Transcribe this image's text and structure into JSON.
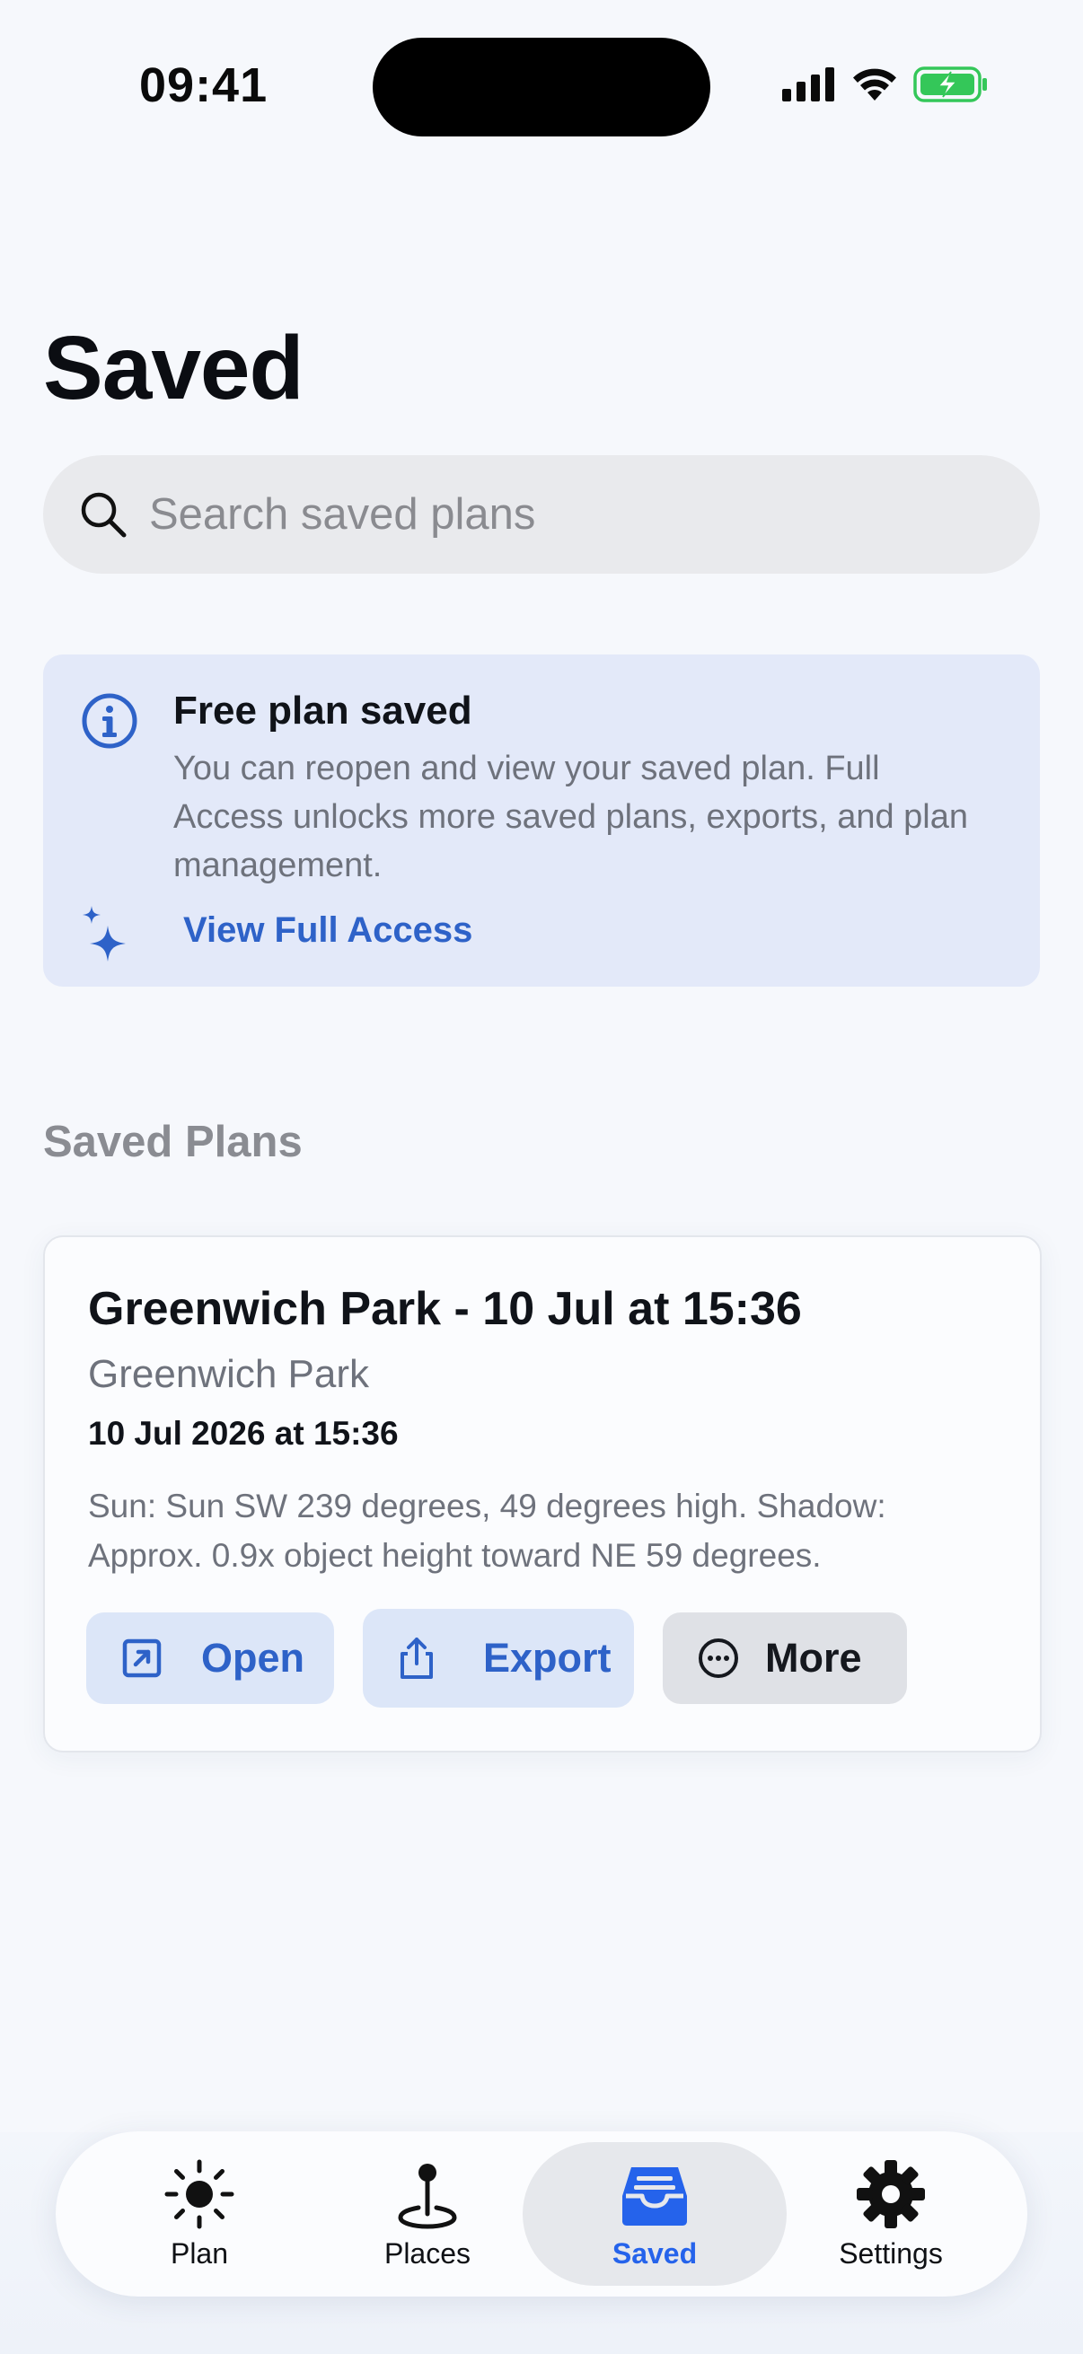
{
  "status_bar": {
    "time": "09:41"
  },
  "header": {
    "title": "Saved"
  },
  "search": {
    "placeholder": "Search saved plans"
  },
  "info_card": {
    "title": "Free plan saved",
    "body": "You can reopen and view your saved plan. Full Access unlocks more saved plans, exports, and plan management.",
    "link_label": "View Full Access"
  },
  "section": {
    "title": "Saved Plans"
  },
  "plans": [
    {
      "title": "Greenwich Park - 10 Jul at 15:36",
      "place": "Greenwich Park",
      "date": "10 Jul 2026 at 15:36",
      "description": "Sun: Sun SW 239 degrees, 49 degrees high. Shadow: Approx. 0.9x object height toward NE 59 degrees.",
      "actions": {
        "open": "Open",
        "export": "Export",
        "more": "More"
      }
    }
  ],
  "tab_bar": {
    "active": "Saved",
    "tabs": [
      {
        "label": "Plan",
        "icon": "sun-icon"
      },
      {
        "label": "Places",
        "icon": "map-pin-icon"
      },
      {
        "label": "Saved",
        "icon": "tray-icon"
      },
      {
        "label": "Settings",
        "icon": "gear-icon"
      }
    ]
  },
  "colors": {
    "accent": "#2563eb",
    "info_background": "#e3e9f9",
    "battery": "#34c759"
  }
}
